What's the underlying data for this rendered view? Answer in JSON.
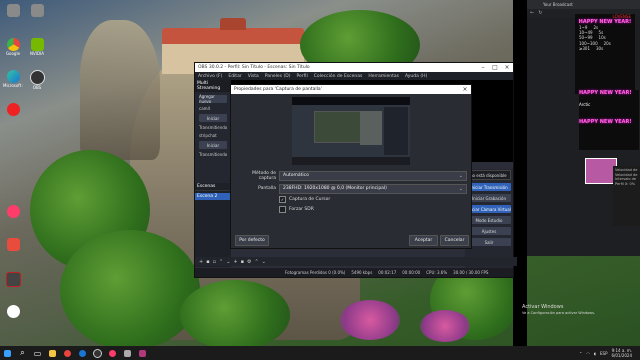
{
  "desktop": {
    "icons": [
      {
        "label": "",
        "color": "#8a8a8a"
      },
      {
        "label": "",
        "color": "#8a8a8a"
      },
      {
        "label": "Google",
        "color": "#e8453c"
      },
      {
        "label": "NVIDIA",
        "color": "#76b900"
      },
      {
        "label": "Microsoft Edge",
        "color": "#1976d2"
      },
      {
        "label": "OBS",
        "color": "#333333"
      },
      {
        "label": "",
        "color": "#e22"
      },
      {
        "label": "",
        "color": "#ff3c6a"
      },
      {
        "label": "",
        "color": "#f2f2f2"
      },
      {
        "label": "",
        "color": "#e74c3c"
      },
      {
        "label": "",
        "color": "#444"
      },
      {
        "label": "",
        "color": "#ffffff"
      }
    ]
  },
  "obs": {
    "title": "OBS 30.0.2 - Perfil: Sin Título - Escenas: Sin Título",
    "menu": [
      "Archivo (F)",
      "Editar",
      "Vista",
      "Paneles (D)",
      "Perfil",
      "Colección de Escenas",
      "Herramientas",
      "Ayuda (H)"
    ],
    "multistream": {
      "header": "Multi Streaming",
      "add_button": "Agregar nuevo",
      "targets": [
        {
          "name": "cam4",
          "button": "Iniciar",
          "label": "Transmitiendo"
        },
        {
          "name": "stripchat",
          "button": "Iniciar",
          "label": "Transmitiendo"
        }
      ]
    },
    "scenes": {
      "header": "Escenas",
      "items": [
        "Escena 2"
      ]
    },
    "controls": {
      "status_text": "no está disponible",
      "buttons": [
        "Iniciar Transmisión",
        "Iniciar Grabación",
        "Iniciar Cámara Virtual",
        "Modo Estudio",
        "Ajustes",
        "Salir"
      ]
    },
    "status": {
      "dropped": "Fotogramas Perdidos 0 (0.0%)",
      "bitrate": "5490 kbps",
      "stream_time": "00:02:17",
      "rec_time": "00:00:00",
      "cpu": "CPU: 3.6%",
      "fps": "30.00 / 30.00 FPS"
    }
  },
  "dialog": {
    "title": "Propiedades para 'Captura de pantalla'",
    "method_label": "Método de captura",
    "method_value": "Automático",
    "screen_label": "Pantalla",
    "screen_value": "238FHD: 1920x1080 @ 0,0 (Monitor principal)",
    "capture_cursor": "Captura de Cursor",
    "capture_cursor_checked": true,
    "force_sdr": "Forzar SDR",
    "force_sdr_checked": false,
    "defaults_button": "Por defecto",
    "accept_button": "Aceptar",
    "cancel_button": "Cancelar"
  },
  "browser": {
    "tab_title": "Your Broadcast",
    "chat_header": "LOVENSE",
    "chat_lines": [
      {
        "a": "1~9",
        "b": "2s"
      },
      {
        "a": "10~49",
        "b": "5s"
      },
      {
        "a": "50~99",
        "b": "10s"
      },
      {
        "a": "100~300",
        "b": "20s"
      },
      {
        "a": "≥301",
        "b": "30s"
      }
    ],
    "neon1": "HAPPY NEW YEAR!",
    "neon2": "HAPPY NEW YEAR!",
    "neon3": "HAPPY NEW YEAR!",
    "user": "Arctic",
    "panel_lines": [
      "Velocidad de",
      "Velocidad de",
      "Intervalo de",
      "Perfil X: 0%"
    ]
  },
  "windows": {
    "activate_title": "Activar Windows",
    "activate_sub": "Ve a Configuración para activar Windows.",
    "tray_lang": "ESP",
    "time": "9:14 a. m.",
    "date": "6/01/2024"
  }
}
